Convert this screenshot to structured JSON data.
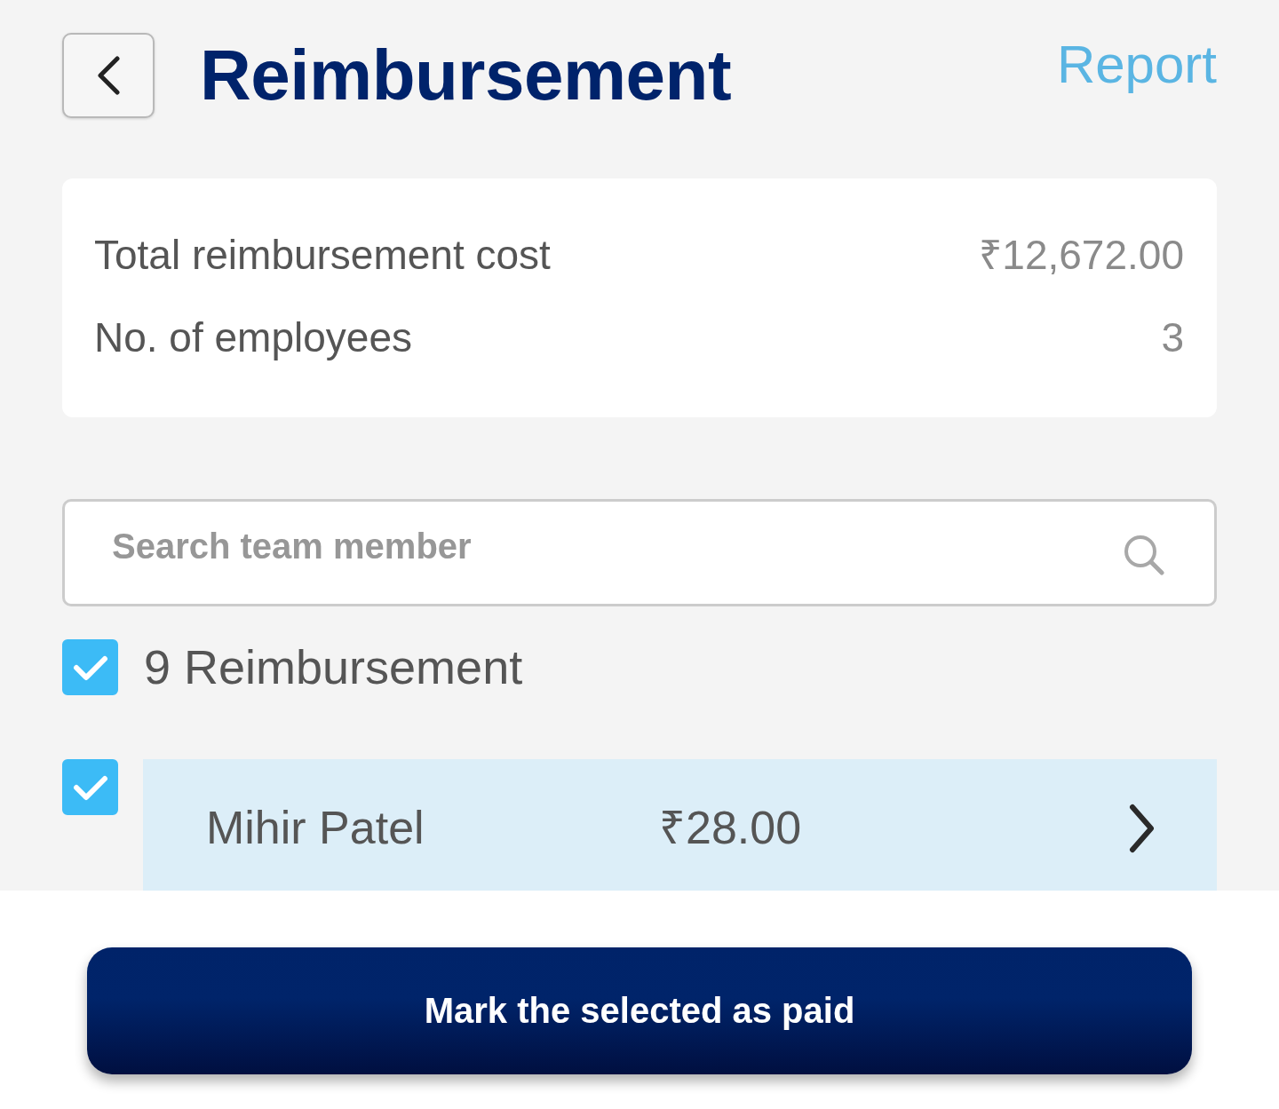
{
  "header": {
    "title": "Reimbursement",
    "report_link": "Report"
  },
  "summary": [
    {
      "label": "Total reimbursement cost",
      "value": "₹12,672.00"
    },
    {
      "label": "No. of employees",
      "value": "3"
    }
  ],
  "search": {
    "placeholder": "Search team member"
  },
  "select_all": {
    "label": "9 Reimbursement",
    "checked": true
  },
  "items": [
    {
      "name": "Mihir Patel",
      "amount": "₹28.00",
      "checked": true
    }
  ],
  "footer": {
    "button": "Mark the selected as paid"
  }
}
